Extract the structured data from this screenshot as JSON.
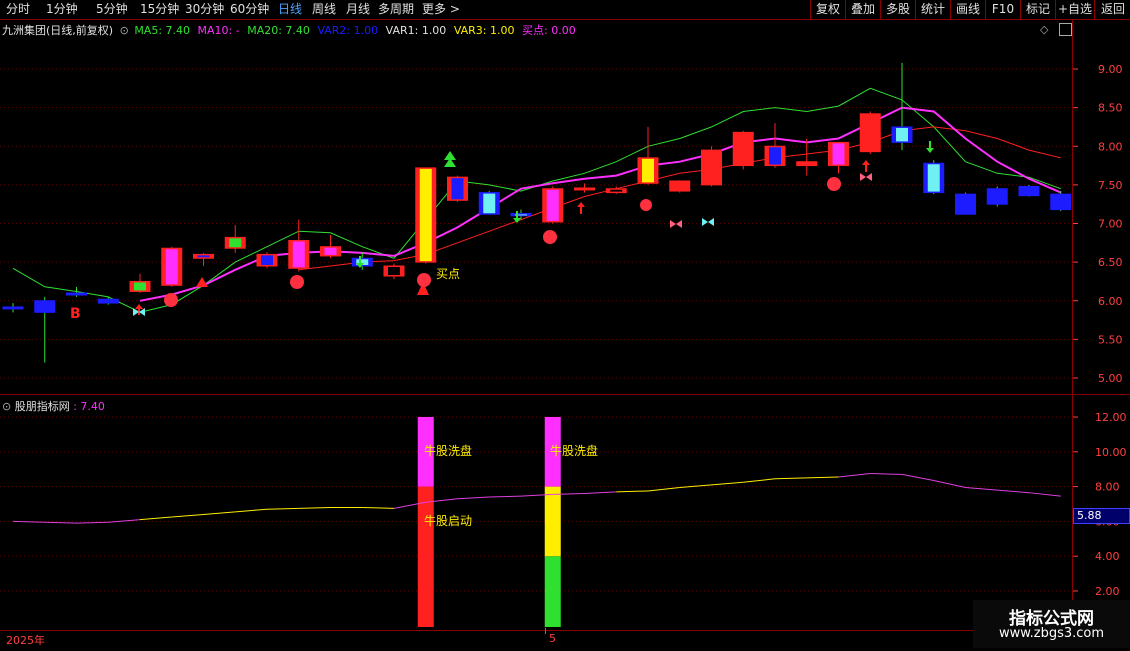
{
  "toolbar": {
    "periods": [
      "分时",
      "1分钟",
      "5分钟",
      "15分钟",
      "30分钟",
      "60分钟",
      "日线",
      "周线",
      "月线",
      "多周期",
      "更多 >"
    ],
    "active_period": "日线",
    "right_buttons": [
      "复权",
      "叠加",
      "多股",
      "统计",
      "画线",
      "F10",
      "标记",
      "+自选",
      "返回"
    ]
  },
  "main_legend": {
    "stock": "九洲集团(日线,前复权)",
    "ma5": "MA5: 7.40",
    "ma10": "MA10: -",
    "ma20": "MA20: 7.40",
    "var2": "VAR2: 1.00",
    "var1": "VAR1: 1.00",
    "var3": "VAR3: 1.00",
    "buy": "买点: 0.00"
  },
  "main_annotations": {
    "b_label": "B",
    "buy_label": "买点"
  },
  "sub_legend": {
    "name": "股朋指标网",
    "value": ": 7.40"
  },
  "sub_annotations": {
    "wash1": "牛股洗盘",
    "wash2": "牛股洗盘",
    "start": "牛股启动"
  },
  "price_axis": {
    "main_ticks": [
      "9.00",
      "8.50",
      "8.00",
      "7.50",
      "7.00",
      "6.50",
      "6.00",
      "5.50",
      "5.00"
    ],
    "sub_ticks": [
      "12.00",
      "10.00",
      "8.00",
      "6.00",
      "4.00",
      "2.00"
    ],
    "current_value": "5.88"
  },
  "bottom_axis": {
    "year": "2025年",
    "month": "5"
  },
  "watermark": {
    "title": "指标公式网",
    "url": "www.zbgs3.com"
  },
  "colors": {
    "up": "#ff2020",
    "down": "#1c1cff",
    "ma5": "#ff30ff",
    "ma10": "#ff2020",
    "ma20": "#30e030",
    "border": "#800000"
  },
  "chart_data": {
    "type": "candlestick",
    "ylim": [
      4.8,
      9.2
    ],
    "candles": [
      {
        "o": 5.92,
        "h": 5.97,
        "l": 5.85,
        "c": 5.9,
        "fill": "#1c1cff"
      },
      {
        "o": 6.0,
        "h": 6.05,
        "l": 5.2,
        "c": 5.85,
        "fill": "#1c1cff"
      },
      {
        "o": 6.1,
        "h": 6.18,
        "l": 6.05,
        "c": 6.08,
        "fill": "#1c1cff"
      },
      {
        "o": 6.02,
        "h": 6.05,
        "l": 5.95,
        "c": 5.97,
        "fill": "#1c1cff"
      },
      {
        "o": 6.12,
        "h": 6.35,
        "l": 6.1,
        "c": 6.25,
        "fill": "#30e030"
      },
      {
        "o": 6.2,
        "h": 6.7,
        "l": 6.18,
        "c": 6.68,
        "fill": "#ff30ff"
      },
      {
        "o": 6.55,
        "h": 6.62,
        "l": 6.45,
        "c": 6.6,
        "fill": "#1c1cff"
      },
      {
        "o": 6.68,
        "h": 6.98,
        "l": 6.62,
        "c": 6.82,
        "fill": "#30e030"
      },
      {
        "o": 6.45,
        "h": 6.63,
        "l": 6.42,
        "c": 6.6,
        "fill": "#1c1cff"
      },
      {
        "o": 6.42,
        "h": 7.05,
        "l": 6.38,
        "c": 6.78,
        "fill": "#ff30ff"
      },
      {
        "o": 6.58,
        "h": 6.85,
        "l": 6.55,
        "c": 6.7,
        "fill": "#ff30ff"
      },
      {
        "o": 6.55,
        "h": 6.63,
        "l": 6.4,
        "c": 6.45,
        "fill": "#70f0f0"
      },
      {
        "o": 6.32,
        "h": 6.48,
        "l": 6.28,
        "c": 6.45,
        "fill": "#000"
      },
      {
        "o": 6.5,
        "h": 7.72,
        "l": 6.48,
        "c": 7.72,
        "fill": "#ffee00"
      },
      {
        "o": 7.3,
        "h": 7.62,
        "l": 7.28,
        "c": 7.6,
        "fill": "#1c1cff"
      },
      {
        "o": 7.4,
        "h": 7.42,
        "l": 7.12,
        "c": 7.12,
        "fill": "#70f0f0"
      },
      {
        "o": 7.13,
        "h": 7.18,
        "l": 7.05,
        "c": 7.1,
        "fill": "#70f0f0"
      },
      {
        "o": 7.02,
        "h": 7.48,
        "l": 7.0,
        "c": 7.45,
        "fill": "#ff30ff"
      },
      {
        "o": 7.45,
        "h": 7.52,
        "l": 7.4,
        "c": 7.46,
        "fill": "#ff2020"
      },
      {
        "o": 7.4,
        "h": 7.48,
        "l": 7.38,
        "c": 7.45,
        "fill": "#000"
      },
      {
        "o": 7.52,
        "h": 8.25,
        "l": 7.5,
        "c": 7.85,
        "fill": "#ffee00"
      },
      {
        "o": 7.42,
        "h": 7.56,
        "l": 7.4,
        "c": 7.55,
        "fill": "#ff2020"
      },
      {
        "o": 7.5,
        "h": 8.0,
        "l": 7.48,
        "c": 7.95,
        "fill": "#ff2020"
      },
      {
        "o": 7.75,
        "h": 8.2,
        "l": 7.7,
        "c": 8.18,
        "fill": "#ff2020"
      },
      {
        "o": 7.75,
        "h": 8.3,
        "l": 7.72,
        "c": 8.0,
        "fill": "#1c1cff"
      },
      {
        "o": 7.75,
        "h": 8.1,
        "l": 7.62,
        "c": 7.8,
        "fill": "#ff2020"
      },
      {
        "o": 7.75,
        "h": 8.05,
        "l": 7.65,
        "c": 8.05,
        "fill": "#ff30ff"
      },
      {
        "o": 7.93,
        "h": 8.45,
        "l": 7.9,
        "c": 8.42,
        "fill": "#ff2020"
      },
      {
        "o": 8.25,
        "h": 9.08,
        "l": 7.95,
        "c": 8.05,
        "fill": "#70f0f0"
      },
      {
        "o": 7.78,
        "h": 7.82,
        "l": 7.38,
        "c": 7.4,
        "fill": "#70f0f0"
      },
      {
        "o": 7.38,
        "h": 7.4,
        "l": 7.12,
        "c": 7.12,
        "fill": "#1c1cff"
      },
      {
        "o": 7.45,
        "h": 7.48,
        "l": 7.22,
        "c": 7.25,
        "fill": "#1c1cff"
      },
      {
        "o": 7.48,
        "h": 7.5,
        "l": 7.35,
        "c": 7.36,
        "fill": "#1c1cff"
      },
      {
        "o": 7.38,
        "h": 7.42,
        "l": 7.16,
        "c": 7.18,
        "fill": "#1c1cff"
      }
    ],
    "ma5": [
      null,
      null,
      null,
      null,
      6.0,
      6.08,
      6.2,
      6.4,
      6.58,
      6.62,
      6.64,
      6.62,
      6.58,
      6.75,
      6.95,
      7.2,
      7.45,
      7.52,
      7.58,
      7.62,
      7.75,
      7.8,
      7.9,
      8.05,
      8.1,
      8.05,
      8.1,
      8.3,
      8.5,
      8.45,
      8.1,
      7.8,
      7.58,
      7.4
    ],
    "ma10": [
      null,
      null,
      null,
      null,
      null,
      null,
      null,
      null,
      null,
      6.4,
      6.45,
      6.5,
      6.52,
      6.6,
      6.75,
      6.9,
      7.05,
      7.2,
      7.35,
      7.45,
      7.55,
      7.65,
      7.7,
      7.78,
      7.85,
      7.9,
      7.95,
      8.05,
      8.2,
      8.25,
      8.2,
      8.1,
      7.95,
      7.85
    ],
    "ma20": [
      6.42,
      6.18,
      6.12,
      6.05,
      5.85,
      5.95,
      6.2,
      6.5,
      6.7,
      6.9,
      6.88,
      6.7,
      6.55,
      7.05,
      7.55,
      7.5,
      7.42,
      7.55,
      7.65,
      7.8,
      8.0,
      8.1,
      8.25,
      8.45,
      8.5,
      8.45,
      8.52,
      8.75,
      8.6,
      8.25,
      7.8,
      7.65,
      7.6,
      7.45
    ],
    "sub_ylim": [
      0,
      13
    ],
    "sub_line": [
      6.0,
      5.95,
      5.9,
      5.95,
      6.1,
      6.25,
      6.4,
      6.55,
      6.7,
      6.75,
      6.8,
      6.8,
      6.75,
      7.1,
      7.3,
      7.4,
      7.45,
      7.55,
      7.6,
      7.7,
      7.75,
      7.95,
      8.1,
      8.25,
      8.45,
      8.5,
      8.55,
      8.75,
      8.7,
      8.35,
      7.95,
      7.8,
      7.65,
      7.45
    ],
    "sub_bars": [
      {
        "index": 13,
        "segments": [
          {
            "from": 0,
            "to": 8,
            "color": "#ff2020"
          },
          {
            "from": 8,
            "to": 12,
            "color": "#ff30ff"
          }
        ]
      },
      {
        "index": 17,
        "segments": [
          {
            "from": 0,
            "to": 4,
            "color": "#30e030"
          },
          {
            "from": 4,
            "to": 8,
            "color": "#ffee00"
          },
          {
            "from": 8,
            "to": 12,
            "color": "#ff30ff"
          }
        ]
      }
    ]
  }
}
